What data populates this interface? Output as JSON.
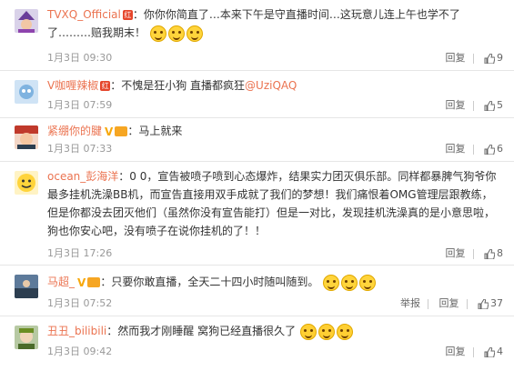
{
  "comments": [
    {
      "user": "TVXQ_Official",
      "badge": "红",
      "text": "：你你你简直了…本来下午是守直播时间…这玩意儿连上午也学不了了………赔我期末！",
      "time": "1月3日 09:30",
      "reply": "回复",
      "likes": "9"
    },
    {
      "user": "V咖喱辣椒",
      "badge": "红",
      "text": "：不愧是狂小狗 直播都疯狂",
      "mention": "@UziQAQ",
      "time": "1月3日 07:59",
      "reply": "回复",
      "likes": "5"
    },
    {
      "user": "紧绷你的腱",
      "text": "：马上就来",
      "time": "1月3日 07:33",
      "reply": "回复",
      "likes": "6"
    },
    {
      "user": "ocean_彭海洋",
      "text": "：0 0，宣告被喷子喷到心态爆炸，结果实力团灭俱乐部。同样都暴脾气狗爷你最多挂机洗澡BB机，而宣告直接用双手成就了我们的梦想！我们痛恨着OMG管理层跟教练，但是你都没去团灭他们（虽然你没有宣告能打）但是一对比，发现挂机洗澡真的是小意思啦，狗也你安心吧，没有喷子在说你挂机的了！！",
      "time": "1月3日 17:26",
      "reply": "回复",
      "likes": "8"
    },
    {
      "user": "马超_",
      "text": "：只要你敢直播，全天二十四小时随叫随到。",
      "time": "1月3日 07:52",
      "report": "举报",
      "reply": "回复",
      "likes": "37"
    },
    {
      "user": "丑丑_bilibili",
      "text": "：然而我才刚睡醒 窝狗已经直播很久了",
      "time": "1月3日 09:42",
      "reply": "回复",
      "likes": "4"
    }
  ]
}
